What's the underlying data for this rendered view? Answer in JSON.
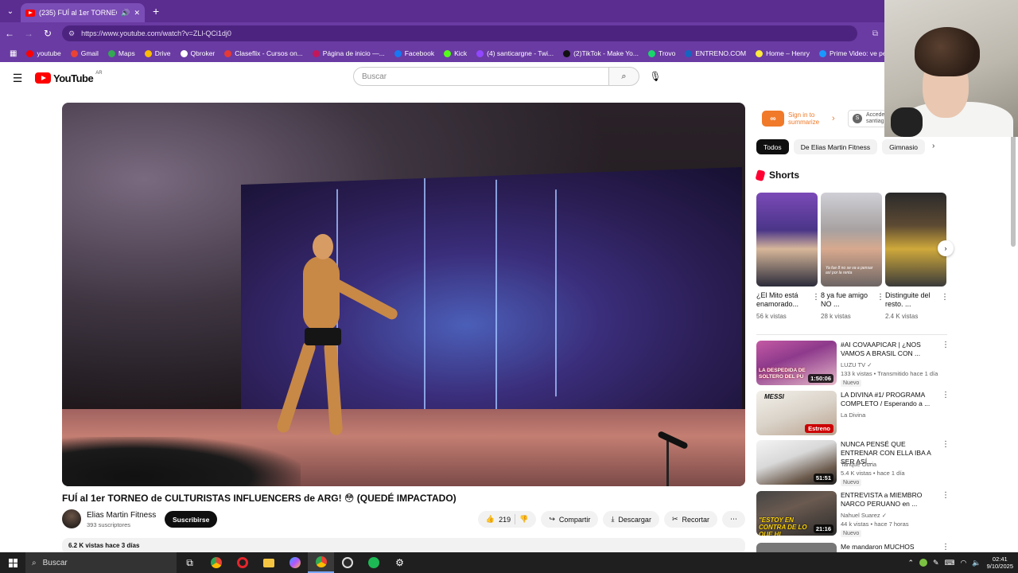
{
  "browser": {
    "tab_title": "(235) FUÍ al 1er TORNEO de",
    "new_tab_symbol": "+",
    "url": "https://www.youtube.com/watch?v=ZLl-QCi1dj0",
    "bookmarks": [
      {
        "label": "youtube",
        "color": "#ff0000"
      },
      {
        "label": "Gmail",
        "color": "#ea4335"
      },
      {
        "label": "Maps",
        "color": "#34a853"
      },
      {
        "label": "Drive",
        "color": "#fbbc04"
      },
      {
        "label": "Qbroker",
        "color": "#ffffff"
      },
      {
        "label": "Claseflix - Cursos on...",
        "color": "#e53935"
      },
      {
        "label": "Página de inicio —...",
        "color": "#c2185b"
      },
      {
        "label": "Facebook",
        "color": "#1877f2"
      },
      {
        "label": "Kick",
        "color": "#53fc18"
      },
      {
        "label": "(4) santicargne - Twi...",
        "color": "#9146ff"
      },
      {
        "label": "(2)TikTok - Make Yo...",
        "color": "#111111"
      },
      {
        "label": "Trovo",
        "color": "#19d66b"
      },
      {
        "label": "ENTRENO.COM",
        "color": "#1565c0"
      },
      {
        "label": "Home – Henry",
        "color": "#ffeb3b"
      },
      {
        "label": "Prime Video: ve pelí...",
        "color": "#1a98ff"
      }
    ]
  },
  "youtube": {
    "logo_text": "YouTube",
    "country_code": "AR",
    "search_placeholder": "Buscar"
  },
  "video": {
    "title": "FUÍ al 1er TORNEO de CULTURISTAS INFLUENCERS de ARG! 😳 (QUEDÉ IMPACTADO)",
    "channel_name": "Elias Martin Fitness",
    "subscribers": "393 suscriptores",
    "subscribe_label": "Suscribirse",
    "likes": "219",
    "share_label": "Compartir",
    "download_label": "Descargar",
    "clip_label": "Recortar",
    "description_meta": "6.2 K vistas  hace 3 días"
  },
  "sidebar": {
    "summarize_label": "Sign in to summarize",
    "acceder_label": "Acceder santiag",
    "acceder_initial": "S",
    "chips": [
      "Todos",
      "De Elias Martin Fitness",
      "Gimnasio"
    ],
    "shorts_heading": "Shorts",
    "shorts": [
      {
        "title": "¿El Mito está enamorado...",
        "views": "56 k vistas",
        "overlay": ""
      },
      {
        "title": "8 ya fue amigo NO ...",
        "views": "28 k vistas",
        "overlay": "Ya fue 8 no se va a pensar así por la renta"
      },
      {
        "title": "Distinguite del resto. ...",
        "views": "2.4 K vistas",
        "overlay": ""
      }
    ],
    "recommendations": [
      {
        "title": "#AI COVAAPICAR | ¿NOS VAMOS A BRASIL CON ...",
        "channel": "LUZU TV ✓",
        "meta": "133 k vistas • Transmitido hace 1 día",
        "badge": "Nuevo",
        "duration": "1:50:06",
        "thumb_caption": "LA DESPEDIDA DE SOLTERO DEL PU"
      },
      {
        "title": "LA DIVINA #1/ PROGRAMA COMPLETO / Esperando a ...",
        "channel": "La Divina",
        "meta": "",
        "badge": "",
        "duration": "Estreno",
        "thumb_caption": "MESSI"
      },
      {
        "title": "NUNCA PENSÉ QUE ENTRENAR CON ELLA IBA A SER ASÍ...",
        "channel": "Tanque Ouria",
        "meta": "5.4 K vistas • hace 1 día",
        "badge": "Nuevo",
        "duration": "51:51",
        "thumb_caption": ""
      },
      {
        "title": "ENTREVISTA a MIEMBRO NARCO PERUANO en ...",
        "channel": "Nahuel Suarez ✓",
        "meta": "44 k vistas • hace 7 horas",
        "badge": "Nuevo",
        "duration": "21:16",
        "thumb_caption": "\"ESTOY EN CONTRA DE LO QUE HI"
      },
      {
        "title": "Me mandaron MUCHOS",
        "channel": "",
        "meta": "",
        "badge": "",
        "duration": "",
        "thumb_caption": ""
      }
    ]
  },
  "taskbar": {
    "search_label": "Buscar",
    "time": "02:41",
    "date": "9/10/2025"
  },
  "colors": {
    "chrome_purple": "#5b2d91",
    "yt_red": "#ff0000"
  }
}
